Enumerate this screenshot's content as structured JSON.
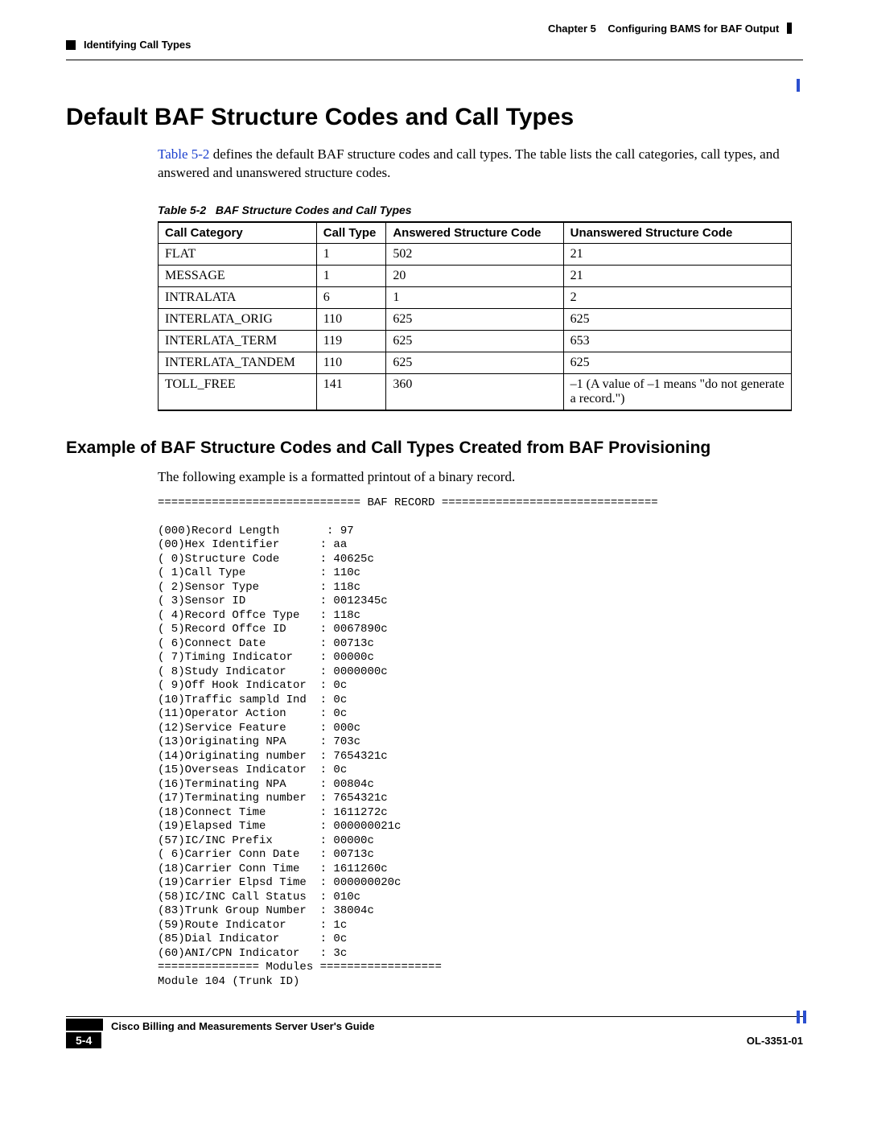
{
  "header": {
    "chapter_label": "Chapter 5",
    "chapter_title": "Configuring BAMS for BAF Output",
    "section_title": "Identifying Call Types"
  },
  "title": "Default BAF Structure Codes and Call Types",
  "intro": {
    "xref": "Table 5-2",
    "rest": " defines the default BAF structure codes and call types. The table lists the call categories, call types, and answered and unanswered structure codes."
  },
  "table": {
    "caption_label": "Table 5-2",
    "caption_title": "BAF Structure Codes and Call Types",
    "headers": [
      "Call Category",
      "Call Type",
      "Answered Structure Code",
      "Unanswered Structure Code"
    ],
    "rows": [
      [
        "FLAT",
        "1",
        "502",
        "21"
      ],
      [
        "MESSAGE",
        "1",
        "20",
        "21"
      ],
      [
        "INTRALATA",
        "6",
        "1",
        "2"
      ],
      [
        "INTERLATA_ORIG",
        "110",
        "625",
        "625"
      ],
      [
        "INTERLATA_TERM",
        "119",
        "625",
        "653"
      ],
      [
        "INTERLATA_TANDEM",
        "110",
        "625",
        "625"
      ],
      [
        "TOLL_FREE",
        "141",
        "360",
        "–1 (A value of –1 means \"do not generate a record.\")"
      ]
    ]
  },
  "subheading": "Example of BAF Structure Codes and Call Types Created from BAF Provisioning",
  "lead": "The following example is a formatted printout of a binary record.",
  "baf_record": "============================== BAF RECORD ================================\n\n(000)Record Length       : 97\n(00)Hex Identifier      : aa\n( 0)Structure Code      : 40625c\n( 1)Call Type           : 110c\n( 2)Sensor Type         : 118c\n( 3)Sensor ID           : 0012345c\n( 4)Record Offce Type   : 118c\n( 5)Record Offce ID     : 0067890c\n( 6)Connect Date        : 00713c\n( 7)Timing Indicator    : 00000c\n( 8)Study Indicator     : 0000000c\n( 9)Off Hook Indicator  : 0c\n(10)Traffic sampld Ind  : 0c\n(11)Operator Action     : 0c\n(12)Service Feature     : 000c\n(13)Originating NPA     : 703c\n(14)Originating number  : 7654321c\n(15)Overseas Indicator  : 0c\n(16)Terminating NPA     : 00804c\n(17)Terminating number  : 7654321c\n(18)Connect Time        : 1611272c\n(19)Elapsed Time        : 000000021c\n(57)IC/INC Prefix       : 00000c\n( 6)Carrier Conn Date   : 00713c\n(18)Carrier Conn Time   : 1611260c\n(19)Carrier Elpsd Time  : 000000020c\n(58)IC/INC Call Status  : 010c\n(83)Trunk Group Number  : 38004c\n(59)Route Indicator     : 1c\n(85)Dial Indicator      : 0c\n(60)ANI/CPN Indicator   : 3c\n=============== Modules ==================\nModule 104 (Trunk ID)",
  "footer": {
    "guide": "Cisco Billing and Measurements Server User's Guide",
    "page": "5-4",
    "doc_id": "OL-3351-01"
  }
}
